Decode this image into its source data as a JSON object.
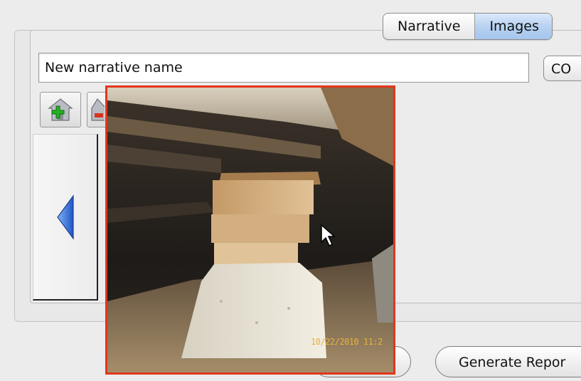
{
  "tabs": [
    {
      "label": "Narrative",
      "selected": false
    },
    {
      "label": "Images",
      "selected": true
    }
  ],
  "narrative_name": {
    "value": "New narrative name"
  },
  "co_button": {
    "label": "CO"
  },
  "toolbar": {
    "add_icon": "house-add-icon",
    "delete_icon": "house-delete-icon"
  },
  "navigation": {
    "previous_icon": "arrow-left-icon"
  },
  "footer": {
    "generate_report_label": "Generate Repor"
  },
  "preview": {
    "timestamp": "10/22/2010 11:2"
  },
  "colors": {
    "popup_border": "#e2361b",
    "arrow_blue": "#2f6bd6",
    "tab_selected": "#b8d2f1"
  }
}
